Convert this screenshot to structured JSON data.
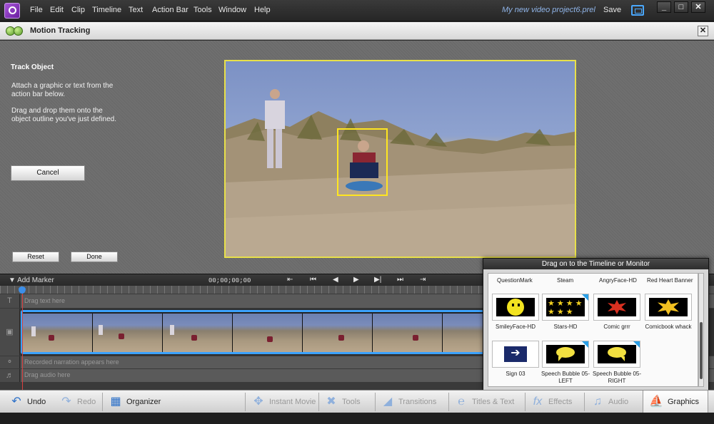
{
  "app": {
    "menu": [
      "File",
      "Edit",
      "Clip",
      "Timeline",
      "Text",
      "Action Bar",
      "Tools",
      "Window",
      "Help"
    ],
    "project_title": "My new video project6.prel",
    "save_label": "Save",
    "window_controls": [
      "_",
      "□",
      "✕"
    ]
  },
  "panel": {
    "title": "Motion Tracking",
    "close": "✕"
  },
  "instructions": {
    "heading": "Track Object",
    "line1": "Attach a graphic or text from the action bar below.",
    "line2": "Drag and drop them onto the object outline you've just defined.",
    "cancel": "Cancel",
    "reset": "Reset",
    "done": "Done"
  },
  "transport": {
    "add_marker": "Add Marker",
    "timecode": "00;00;00;00",
    "buttons": [
      "⇤",
      "⏮",
      "◀",
      "▶",
      "▶|",
      "⏭",
      "⇥"
    ]
  },
  "timeline": {
    "text_track_placeholder": "Drag text here",
    "narration_placeholder": "Recorded narration appears here",
    "audio_placeholder": "Drag audio here"
  },
  "graphics_panel": {
    "header": "Drag on to the Timeline or Monitor",
    "column_labels": [
      "QuestionMark",
      "Steam",
      "AngryFace-HD",
      "Red Heart Banner"
    ],
    "items": [
      {
        "label": "SmileyFace-HD",
        "icon": "smiley-face"
      },
      {
        "label": "Stars-HD",
        "icon": "stars"
      },
      {
        "label": "Comic grrr",
        "icon": "comic-burst"
      },
      {
        "label": "Comicbook whack",
        "icon": "comic-burst-yellow"
      },
      {
        "label": "Sign 03",
        "icon": "arrow-sign"
      },
      {
        "label": "Speech Bubble 05-LEFT",
        "icon": "speech-bubble"
      },
      {
        "label": "Speech Bubble 05-RIGHT",
        "icon": "speech-bubble"
      }
    ]
  },
  "action_bar": {
    "undo": "Undo",
    "redo": "Redo",
    "organizer": "Organizer",
    "instant_movie": "Instant Movie",
    "tools": "Tools",
    "transitions": "Transitions",
    "titles_text": "Titles & Text",
    "effects": "Effects",
    "audio": "Audio",
    "graphics": "Graphics"
  },
  "colors": {
    "tracking_box": "#ffe620",
    "clip_border": "#3ba2ff",
    "project_title": "#8fb4e8"
  }
}
